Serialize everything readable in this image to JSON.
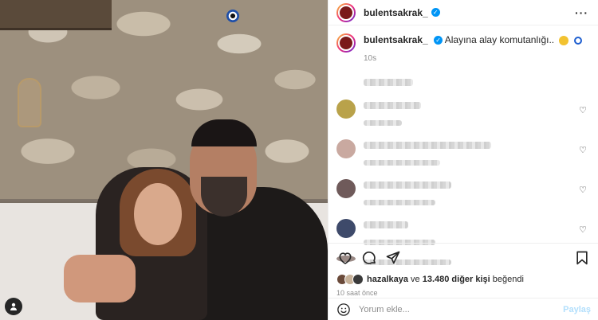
{
  "post": {
    "username": "bulentsakrak_",
    "caption": "Alayına alay komutanlığı..",
    "caption_time": "10s",
    "likes": {
      "liker": "hazalkaya",
      "connector": "ve",
      "others": "13.480 diğer kişi",
      "suffix": "beğendi"
    },
    "posted_ago": "10 saat önce"
  },
  "comment_input": {
    "placeholder": "Yorum ekle...",
    "post_label": "Paylaş"
  },
  "icons": {
    "verified": "verified-badge-icon",
    "more": "more-options-icon",
    "like": "heart-icon",
    "comment": "comment-bubble-icon",
    "share": "send-paper-plane-icon",
    "save": "bookmark-icon",
    "emoji": "smiley-icon",
    "tag": "person-tag-icon"
  },
  "colors": {
    "verified": "#0095f6",
    "link": "#b2dffc",
    "muted": "#8e8e8e"
  }
}
